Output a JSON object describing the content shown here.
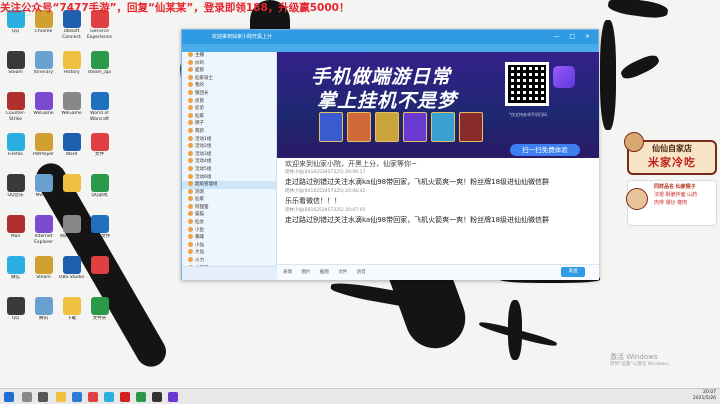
{
  "banner": {
    "text": "关注公众号“7477手游”，回复“仙某某”，登录即领188，升级赢5000！"
  },
  "desktop": {
    "icons": [
      {
        "label": "QQ"
      },
      {
        "label": "Chrome"
      },
      {
        "label": "Ubisoft Connect"
      },
      {
        "label": "GeForce Experience"
      },
      {
        "label": "Steam"
      },
      {
        "label": "Itinerary"
      },
      {
        "label": "History"
      },
      {
        "label": "steam_api"
      },
      {
        "label": "Counter-Strike"
      },
      {
        "label": "WeGame"
      },
      {
        "label": "WeGame"
      },
      {
        "label": "World of Warcraft"
      },
      {
        "label": "Firefox"
      },
      {
        "label": "PotPlayer"
      },
      {
        "label": "Word"
      },
      {
        "label": "文件"
      },
      {
        "label": "QQ音乐"
      },
      {
        "label": "NVIDIA"
      },
      {
        "label": "文件夹"
      },
      {
        "label": "QQ游戏"
      },
      {
        "label": "Mail"
      },
      {
        "label": "Internet Explorer"
      },
      {
        "label": "网易云音乐"
      },
      {
        "label": "mode文件"
      },
      {
        "label": "微信"
      },
      {
        "label": "Steam"
      },
      {
        "label": "OBS Studio"
      },
      {
        "label": "Geany"
      },
      {
        "label": "QQ"
      },
      {
        "label": "腾讯"
      },
      {
        "label": "下载"
      },
      {
        "label": "文件夹"
      }
    ]
  },
  "qq_window": {
    "title": "欢迎来到仙家小院开黑上分",
    "controls": "— □ ✕",
    "groups": [
      {
        "name": "主播",
        "selected": false
      },
      {
        "name": "炒鸡",
        "selected": false
      },
      {
        "name": "超管",
        "selected": false
      },
      {
        "name": "仙家骑士",
        "selected": false
      },
      {
        "name": "我的",
        "selected": false
      },
      {
        "name": "狼团长",
        "selected": false
      },
      {
        "name": "房管",
        "selected": false
      },
      {
        "name": "徒弟",
        "selected": false
      },
      {
        "name": "仙家",
        "selected": false
      },
      {
        "name": "牌子",
        "selected": false
      },
      {
        "name": "萌新",
        "selected": false
      },
      {
        "name": "活动1组",
        "selected": false
      },
      {
        "name": "活动2组",
        "selected": false
      },
      {
        "name": "活动3组",
        "selected": false
      },
      {
        "name": "活动4组",
        "selected": false
      },
      {
        "name": "活动5组",
        "selected": false
      },
      {
        "name": "活动6组",
        "selected": false
      },
      {
        "name": "超级管理组",
        "selected": true
      },
      {
        "name": "洞洞",
        "selected": false
      },
      {
        "name": "仙家",
        "selected": false
      },
      {
        "name": "阿狸狸",
        "selected": false
      },
      {
        "name": "猫猫",
        "selected": false
      },
      {
        "name": "仙女",
        "selected": false
      },
      {
        "name": "小鱼",
        "selected": false
      },
      {
        "name": "暴躁",
        "selected": false
      },
      {
        "name": "小仙",
        "selected": false
      },
      {
        "name": "大仙",
        "selected": false
      },
      {
        "name": "火力",
        "selected": false
      },
      {
        "name": "小管家",
        "selected": false
      }
    ],
    "ad": {
      "line1": "手机做端游日常",
      "line2": "掌上挂机不是梦",
      "button": "扫一扫免费体验",
      "note": "*仅支持安卓手机扫码"
    },
    "messages": [
      {
        "meta": "",
        "text": "欢迎来到仙家小院，开黑上分，仙家等你~"
      },
      {
        "meta": "瑶林小仙(8416253457325)  20:06:17",
        "text": "走过路过别错过关注水滴ka仙98带回家，飞机火箭爽一爽！粉丝牌18级进仙仙微信群"
      },
      {
        "meta": "瑶林小仙(8416253457325)  20:06:42",
        "text": "乐乐看微信！！！"
      },
      {
        "meta": "瑶林小仙(8416253457325)  20:07:05",
        "text": "走过路过别错过关注水滴ka仙98带回家，飞机火箭爽一爽！粉丝牌18级进仙仙微信群"
      }
    ],
    "tools": [
      "表情",
      "图片",
      "截图",
      "文件",
      "语音"
    ],
    "send_label": "发送"
  },
  "shop": {
    "title": "仙仙自家店",
    "slogan": "米家冷吃",
    "line1": "同样品名 仙家猴子",
    "line2": "法棍 酥脆拌面 山药",
    "line3": "肉排 爆炒 瘦肉"
  },
  "watermark": {
    "line1": "激活 Windows",
    "line2": "转到“设置”以激活 Windows。"
  },
  "taskbar": {
    "time": "20:07",
    "date": "2021/5/26"
  }
}
